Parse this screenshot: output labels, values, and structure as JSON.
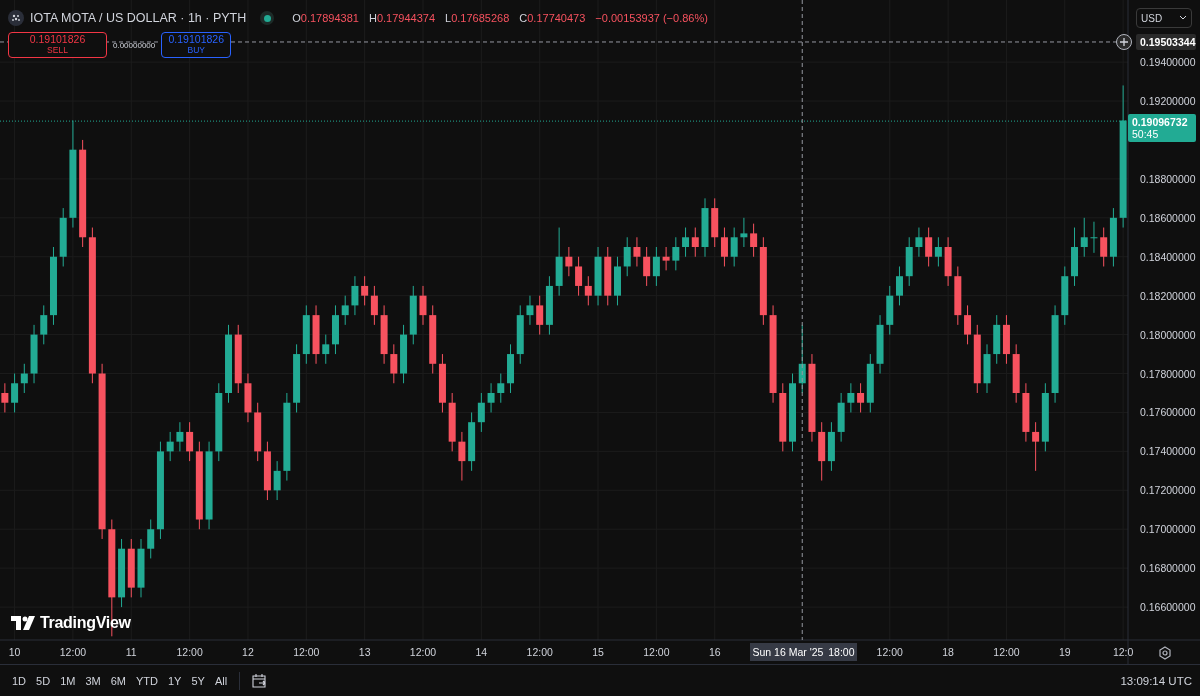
{
  "symbol": {
    "title": "IOTA MOTA / US DOLLAR · 1h · PYTH",
    "market_open": true
  },
  "legend": [
    {
      "label": "O",
      "value": "0.17894381"
    },
    {
      "label": "H",
      "value": "0.17944374"
    },
    {
      "label": "L",
      "value": "0.17685268"
    },
    {
      "label": "C",
      "value": "0.17740473"
    }
  ],
  "change": "−0.00153937 (−0.86%)",
  "trade": {
    "sell_price": "0.19101826",
    "sell_label": "SELL",
    "spread": "0.00000000",
    "buy_price": "0.19101826",
    "buy_label": "BUY"
  },
  "currency": "USD",
  "ask_line": {
    "price": "0.19503344"
  },
  "last_price": {
    "price": "0.19096732",
    "countdown": "50:45"
  },
  "crosshair": {
    "date": "Sun 16 Mar '25",
    "time": "18:00"
  },
  "logo": "TradingView",
  "chart_data": {
    "type": "candlestick",
    "grid": true,
    "ylim": [
      0.16431,
      0.19719
    ],
    "categories": [
      null,
      "10",
      null,
      null,
      null,
      null,
      null,
      "12:00",
      null,
      null,
      null,
      null,
      null,
      "11",
      null,
      null,
      null,
      null,
      null,
      "12:00",
      null,
      null,
      null,
      null,
      null,
      "12",
      null,
      null,
      null,
      null,
      null,
      "12:00",
      null,
      null,
      null,
      null,
      null,
      "13",
      null,
      null,
      null,
      null,
      null,
      "12:00",
      null,
      null,
      null,
      null,
      null,
      "14",
      null,
      null,
      null,
      null,
      null,
      "12:00",
      null,
      null,
      null,
      null,
      null,
      "15",
      null,
      null,
      null,
      null,
      null,
      "12:00",
      null,
      null,
      null,
      null,
      null,
      "16",
      null,
      null,
      null,
      null,
      null,
      null,
      null,
      null,
      null,
      null,
      null,
      null,
      null,
      null,
      null,
      null,
      null,
      "12:00",
      null,
      null,
      null,
      null,
      null,
      "18",
      null,
      null,
      null,
      null,
      null,
      "12:00",
      null,
      null,
      null,
      null,
      null,
      "19",
      null,
      null,
      null,
      null,
      null,
      "12:0"
    ],
    "yticks": [
      {
        "value": 0.194,
        "label": "0.19400000"
      },
      {
        "value": 0.192,
        "label": "0.19200000"
      },
      {
        "value": 0.188,
        "label": "0.18800000"
      },
      {
        "value": 0.186,
        "label": "0.18600000"
      },
      {
        "value": 0.184,
        "label": "0.18400000"
      },
      {
        "value": 0.182,
        "label": "0.18200000"
      },
      {
        "value": 0.18,
        "label": "0.18000000"
      },
      {
        "value": 0.178,
        "label": "0.17800000"
      },
      {
        "value": 0.176,
        "label": "0.17600000"
      },
      {
        "value": 0.174,
        "label": "0.17400000"
      },
      {
        "value": 0.172,
        "label": "0.17200000"
      },
      {
        "value": 0.17,
        "label": "0.17000000"
      },
      {
        "value": 0.168,
        "label": "0.16800000"
      },
      {
        "value": 0.166,
        "label": "0.16600000"
      }
    ],
    "ref_lines": [
      {
        "axis": "y",
        "value": 0.19503344,
        "line_style": "dashed",
        "color": "#9598a1"
      },
      {
        "axis": "y",
        "value": 0.19096732,
        "line_style": "dotted",
        "color": "#22ab94"
      }
    ],
    "ohlc": [
      [
        0.177,
        0.1775,
        0.176,
        0.1765
      ],
      [
        0.1765,
        0.178,
        0.176,
        0.1775
      ],
      [
        0.1775,
        0.1785,
        0.177,
        0.178
      ],
      [
        0.178,
        0.1805,
        0.1775,
        0.18
      ],
      [
        0.18,
        0.1815,
        0.1795,
        0.181
      ],
      [
        0.181,
        0.1845,
        0.1805,
        0.184
      ],
      [
        0.184,
        0.1865,
        0.1835,
        0.186
      ],
      [
        0.186,
        0.191,
        0.1855,
        0.1895
      ],
      [
        0.1895,
        0.19,
        0.1845,
        0.185
      ],
      [
        0.185,
        0.1855,
        0.1775,
        0.178
      ],
      [
        0.178,
        0.1785,
        0.1695,
        0.17
      ],
      [
        0.17,
        0.1705,
        0.1645,
        0.1665
      ],
      [
        0.1665,
        0.1695,
        0.166,
        0.169
      ],
      [
        0.169,
        0.1695,
        0.1665,
        0.167
      ],
      [
        0.167,
        0.1695,
        0.1665,
        0.169
      ],
      [
        0.169,
        0.1705,
        0.1685,
        0.17
      ],
      [
        0.17,
        0.1745,
        0.1695,
        0.174
      ],
      [
        0.174,
        0.175,
        0.1735,
        0.1745
      ],
      [
        0.1745,
        0.1755,
        0.174,
        0.175
      ],
      [
        0.175,
        0.1755,
        0.1735,
        0.174
      ],
      [
        0.174,
        0.1745,
        0.17,
        0.1705
      ],
      [
        0.1705,
        0.1745,
        0.17,
        0.174
      ],
      [
        0.174,
        0.1775,
        0.1735,
        0.177
      ],
      [
        0.177,
        0.1805,
        0.1765,
        0.18
      ],
      [
        0.18,
        0.1805,
        0.177,
        0.1775
      ],
      [
        0.1775,
        0.178,
        0.1755,
        0.176
      ],
      [
        0.176,
        0.1765,
        0.1735,
        0.174
      ],
      [
        0.174,
        0.1745,
        0.1715,
        0.172
      ],
      [
        0.172,
        0.1735,
        0.1715,
        0.173
      ],
      [
        0.173,
        0.177,
        0.1725,
        0.1765
      ],
      [
        0.1765,
        0.1795,
        0.176,
        0.179
      ],
      [
        0.179,
        0.1815,
        0.1785,
        0.181
      ],
      [
        0.181,
        0.1815,
        0.1785,
        0.179
      ],
      [
        0.179,
        0.18,
        0.1785,
        0.1795
      ],
      [
        0.1795,
        0.1815,
        0.179,
        0.181
      ],
      [
        0.181,
        0.182,
        0.1805,
        0.1815
      ],
      [
        0.1815,
        0.183,
        0.181,
        0.1825
      ],
      [
        0.1825,
        0.183,
        0.1815,
        0.182
      ],
      [
        0.182,
        0.1825,
        0.1805,
        0.181
      ],
      [
        0.181,
        0.1815,
        0.1785,
        0.179
      ],
      [
        0.179,
        0.1795,
        0.1775,
        0.178
      ],
      [
        0.178,
        0.1805,
        0.1775,
        0.18
      ],
      [
        0.18,
        0.1825,
        0.1795,
        0.182
      ],
      [
        0.182,
        0.1825,
        0.1805,
        0.181
      ],
      [
        0.181,
        0.1815,
        0.178,
        0.1785
      ],
      [
        0.1785,
        0.179,
        0.176,
        0.1765
      ],
      [
        0.1765,
        0.177,
        0.174,
        0.1745
      ],
      [
        0.1745,
        0.175,
        0.1725,
        0.1735
      ],
      [
        0.1735,
        0.176,
        0.173,
        0.1755
      ],
      [
        0.1755,
        0.177,
        0.175,
        0.1765
      ],
      [
        0.1765,
        0.1775,
        0.176,
        0.177
      ],
      [
        0.177,
        0.178,
        0.1765,
        0.1775
      ],
      [
        0.1775,
        0.1795,
        0.177,
        0.179
      ],
      [
        0.179,
        0.1815,
        0.1785,
        0.181
      ],
      [
        0.181,
        0.182,
        0.1805,
        0.1815
      ],
      [
        0.1815,
        0.182,
        0.18,
        0.1805
      ],
      [
        0.1805,
        0.183,
        0.18,
        0.1825
      ],
      [
        0.1825,
        0.1855,
        0.182,
        0.184
      ],
      [
        0.184,
        0.1845,
        0.183,
        0.1835
      ],
      [
        0.1835,
        0.184,
        0.182,
        0.1825
      ],
      [
        0.1825,
        0.183,
        0.1815,
        0.182
      ],
      [
        0.182,
        0.1845,
        0.1815,
        0.184
      ],
      [
        0.184,
        0.1845,
        0.1815,
        0.182
      ],
      [
        0.182,
        0.184,
        0.1815,
        0.1835
      ],
      [
        0.1835,
        0.185,
        0.183,
        0.1845
      ],
      [
        0.1845,
        0.185,
        0.1835,
        0.184
      ],
      [
        0.184,
        0.1845,
        0.1825,
        0.183
      ],
      [
        0.183,
        0.1845,
        0.1825,
        0.184
      ],
      [
        0.184,
        0.1845,
        0.1833,
        0.1838
      ],
      [
        0.1838,
        0.185,
        0.1833,
        0.1845
      ],
      [
        0.1845,
        0.1855,
        0.184,
        0.185
      ],
      [
        0.185,
        0.1855,
        0.184,
        0.1845
      ],
      [
        0.1845,
        0.187,
        0.184,
        0.1865
      ],
      [
        0.1865,
        0.187,
        0.1845,
        0.185
      ],
      [
        0.185,
        0.1855,
        0.1835,
        0.184
      ],
      [
        0.184,
        0.1855,
        0.1835,
        0.185
      ],
      [
        0.185,
        0.186,
        0.1845,
        0.1852
      ],
      [
        0.1852,
        0.1857,
        0.184,
        0.1845
      ],
      [
        0.1845,
        0.185,
        0.1805,
        0.181
      ],
      [
        0.181,
        0.1815,
        0.1765,
        0.177
      ],
      [
        0.177,
        0.1775,
        0.174,
        0.1745
      ],
      [
        0.1745,
        0.178,
        0.174,
        0.1775
      ],
      [
        0.1775,
        0.1805,
        0.177,
        0.1785
      ],
      [
        0.1785,
        0.179,
        0.1745,
        0.175
      ],
      [
        0.175,
        0.1755,
        0.1725,
        0.1735
      ],
      [
        0.1735,
        0.1755,
        0.173,
        0.175
      ],
      [
        0.175,
        0.177,
        0.1745,
        0.1765
      ],
      [
        0.1765,
        0.1775,
        0.176,
        0.177
      ],
      [
        0.177,
        0.1775,
        0.176,
        0.1765
      ],
      [
        0.1765,
        0.179,
        0.176,
        0.1785
      ],
      [
        0.1785,
        0.181,
        0.178,
        0.1805
      ],
      [
        0.1805,
        0.1825,
        0.18,
        0.182
      ],
      [
        0.182,
        0.1835,
        0.1815,
        0.183
      ],
      [
        0.183,
        0.185,
        0.1825,
        0.1845
      ],
      [
        0.1845,
        0.1855,
        0.184,
        0.185
      ],
      [
        0.185,
        0.1855,
        0.1835,
        0.184
      ],
      [
        0.184,
        0.185,
        0.1835,
        0.1845
      ],
      [
        0.1845,
        0.185,
        0.1825,
        0.183
      ],
      [
        0.183,
        0.1835,
        0.1805,
        0.181
      ],
      [
        0.181,
        0.1815,
        0.1795,
        0.18
      ],
      [
        0.18,
        0.1805,
        0.177,
        0.1775
      ],
      [
        0.1775,
        0.1795,
        0.177,
        0.179
      ],
      [
        0.179,
        0.181,
        0.1785,
        0.1805
      ],
      [
        0.1805,
        0.181,
        0.1785,
        0.179
      ],
      [
        0.179,
        0.1795,
        0.1765,
        0.177
      ],
      [
        0.177,
        0.1775,
        0.1745,
        0.175
      ],
      [
        0.175,
        0.1755,
        0.173,
        0.1745
      ],
      [
        0.1745,
        0.1775,
        0.174,
        0.177
      ],
      [
        0.177,
        0.1815,
        0.1765,
        0.181
      ],
      [
        0.181,
        0.1835,
        0.1805,
        0.183
      ],
      [
        0.183,
        0.1855,
        0.1825,
        0.1845
      ],
      [
        0.1845,
        0.186,
        0.184,
        0.185
      ],
      [
        0.185,
        0.1858,
        0.1842,
        0.185
      ],
      [
        0.185,
        0.1855,
        0.1835,
        0.184
      ],
      [
        0.184,
        0.1865,
        0.1835,
        0.186
      ],
      [
        0.186,
        0.1928,
        0.1855,
        0.191
      ]
    ]
  },
  "ranges": [
    "1D",
    "5D",
    "1M",
    "3M",
    "6M",
    "YTD",
    "1Y",
    "5Y",
    "All"
  ],
  "clock": "13:09:14 UTC"
}
